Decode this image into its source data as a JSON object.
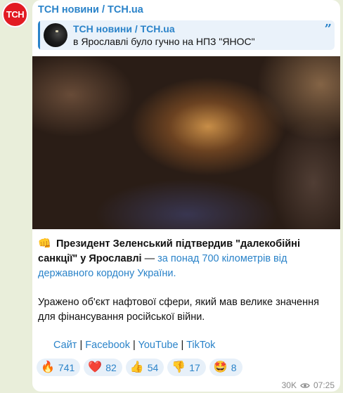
{
  "channel": {
    "avatar_text": "ТСН",
    "name": "ТСН новини / TCH.ua"
  },
  "reply": {
    "title": "ТСН новини / TCH.ua",
    "text": "в Ярославлі було гучно на НПЗ \"ЯНОС\"",
    "icon": "quote-icon"
  },
  "media": {
    "icon": "blurred-video-thumbnail"
  },
  "message": {
    "p1_emoji": "👊",
    "p1_bold": "Президент Зеленський підтвердив \"далекобійні санкції\" у Ярославлі",
    "p1_dash": " — ",
    "p1_link": "за понад 700 кілометрів від державного кордону України.",
    "p2": "Уражено об'єкт нафтової сфери, який мав велике значення для фінансування російської війни."
  },
  "links": {
    "site": "Сайт",
    "facebook": "Facebook",
    "youtube": "YouTube",
    "tiktok": "TikTok",
    "separator": " | "
  },
  "reactions": [
    {
      "emoji": "🔥",
      "count": "741"
    },
    {
      "emoji": "❤️",
      "count": "82"
    },
    {
      "emoji": "👍",
      "count": "54"
    },
    {
      "emoji": "👎",
      "count": "17"
    },
    {
      "emoji": "🤩",
      "count": "8"
    }
  ],
  "footer": {
    "views": "30K",
    "time": "07:25"
  },
  "colors": {
    "accent": "#2a83c9",
    "avatar_bg": "#e21b23",
    "chat_bg": "#e9eeda"
  }
}
